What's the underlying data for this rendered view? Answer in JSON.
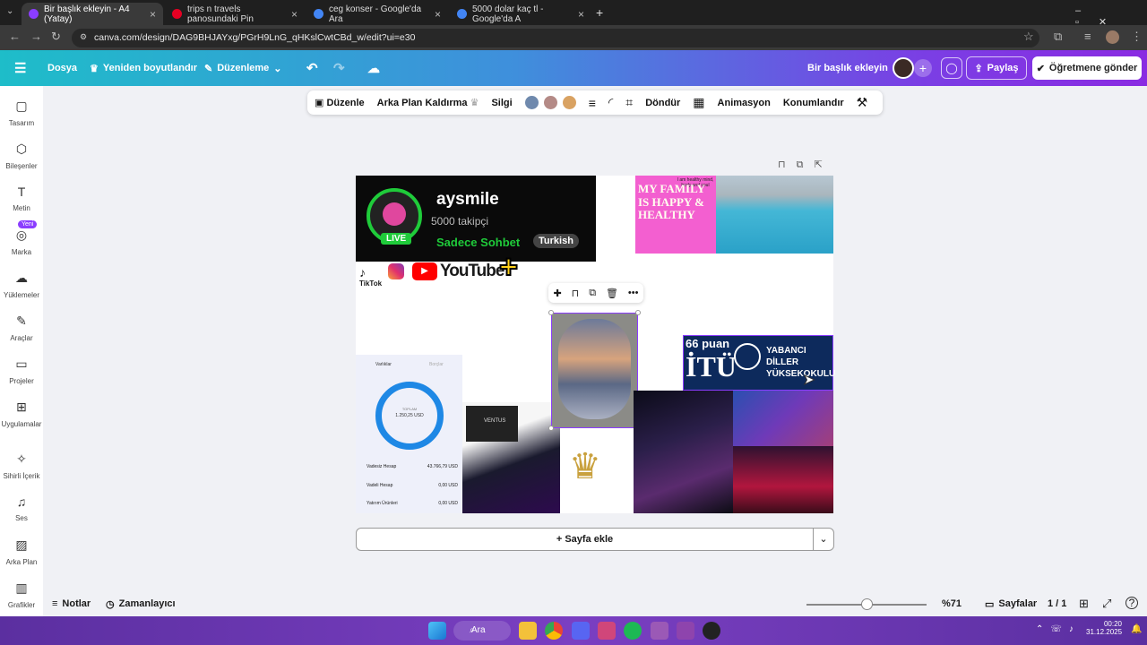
{
  "browser": {
    "tabs": [
      {
        "label": "Bir başlık ekleyin - A4 (Yatay)",
        "color": "#8b3dff"
      },
      {
        "label": "trips n travels panosundaki Pin",
        "color": "#e60023"
      },
      {
        "label": "ceg konser - Google'da Ara",
        "color": "#4285f4"
      },
      {
        "label": "5000 dolar kaç tl - Google'da A",
        "color": "#4285f4"
      }
    ],
    "new_tab": "+",
    "url": "canva.com/design/DAG9BHJAYxg/PGrH9LnG_qHKslCwtCBd_w/edit?ui=e30"
  },
  "header": {
    "file": "Dosya",
    "resize": "Yeniden boyutlandır",
    "edit": "Düzenleme",
    "title": "Bir başlık ekleyin",
    "share": "Paylaş",
    "send": "Öğretmene gönder"
  },
  "sidebar": {
    "items": [
      {
        "label": "Tasarım",
        "icon": "▢"
      },
      {
        "label": "Bileşenler",
        "icon": "⬡"
      },
      {
        "label": "Metin",
        "icon": "T"
      },
      {
        "label": "Marka",
        "icon": "◎"
      },
      {
        "label": "Yüklemeler",
        "icon": "☁"
      },
      {
        "label": "Araçlar",
        "icon": "✎"
      },
      {
        "label": "Projeler",
        "icon": "▭"
      },
      {
        "label": "Uygulamalar",
        "icon": "⊞"
      },
      {
        "label": "Sihirli İçerik",
        "icon": "✧"
      },
      {
        "label": "Ses",
        "icon": "♫"
      },
      {
        "label": "Arka Plan",
        "icon": "▨"
      },
      {
        "label": "Grafikler",
        "icon": "▥"
      }
    ],
    "badge": "Yeni"
  },
  "toolbar": {
    "edit": "Düzenle",
    "bg_remove": "Arka Plan Kaldırma",
    "eraser": "Silgi",
    "colors": [
      "#6f89ad",
      "#b48a86",
      "#d9a262"
    ],
    "rotate": "Döndür",
    "animation": "Animasyon",
    "position": "Konumlandır"
  },
  "canvas": {
    "stream": {
      "name": "aysmile",
      "followers": "5000 takipçi",
      "tag": "Sadece Sohbet",
      "lang": "Turkish",
      "live": "LIVE"
    },
    "social": {
      "tiktok": "TikTok",
      "youtube": "YouTube"
    },
    "family": {
      "small": "I am healthy mind, body and soul",
      "big": "MY FAMILY IS HAPPY & HEALTHY"
    },
    "itu": {
      "score": "66 puan",
      "logo": "İTÜ",
      "school": "YABANCI DİLLER YÜKSEKOKULU"
    },
    "bank": {
      "tab1": "Varlıklar",
      "tab2": "Borçlar",
      "total_label": "TOPLAM",
      "total": "1.250,25 USD",
      "rows": [
        {
          "label": "Vadesiz Hesap",
          "value": "43.766,79 USD"
        },
        {
          "label": "Vadeli Hesap",
          "value": "0,00 USD"
        },
        {
          "label": "Yatırım Ürünleri",
          "value": "0,00 USD"
        }
      ]
    },
    "gpu": "VENTUS",
    "add_page": "+ Sayfa ekle"
  },
  "footer": {
    "notes": "Notlar",
    "timer": "Zamanlayıcı",
    "zoom": "%71",
    "zoom_value": 0.71,
    "pages": "Sayfalar",
    "page_count": "1 / 1"
  },
  "taskbar": {
    "search": "Ara",
    "time": "00:20",
    "date": "31.12.2025"
  }
}
